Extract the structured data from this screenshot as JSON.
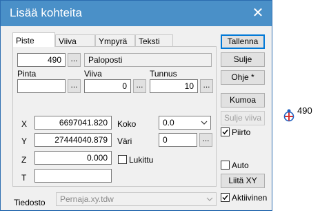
{
  "window": {
    "title": "Lisää kohteita",
    "close_symbol": "✕"
  },
  "tabs": [
    "Piste",
    "Viiva",
    "Ympyrä",
    "Teksti"
  ],
  "code": {
    "value": "490",
    "name": "Paloposti"
  },
  "pinta": {
    "label": "Pinta",
    "value": ""
  },
  "viiva": {
    "label": "Viiva",
    "value": "0"
  },
  "tunnus": {
    "label": "Tunnus",
    "value": "10"
  },
  "dots": "...",
  "coords": {
    "x_label": "X",
    "x_value": "6697041.820",
    "y_label": "Y",
    "y_value": "27444040.879",
    "z_label": "Z",
    "z_value": "0.000",
    "t_label": "T",
    "t_value": ""
  },
  "koko": {
    "label": "Koko",
    "value": "0.0"
  },
  "vari": {
    "label": "Väri",
    "value": "0"
  },
  "lukittu": {
    "label": "Lukittu",
    "checked": false
  },
  "tiedosto": {
    "label": "Tiedosto",
    "value": "Pernaja.xy.tdw"
  },
  "buttons": {
    "tallenna": "Tallenna",
    "sulje": "Sulje",
    "ohje": "Ohje *",
    "kumoa": "Kumoa",
    "sulje_viiva": "Sulje viiva",
    "liita_xy": "Liitä XY"
  },
  "checkboxes": {
    "piirto": {
      "label": "Piirto",
      "checked": true
    },
    "auto": {
      "label": "Auto",
      "checked": false
    },
    "aktiivinen": {
      "label": "Aktiivinen",
      "checked": true
    }
  },
  "marker": {
    "label": "490",
    "icon": "hydrant-marker-icon",
    "color": "#d83030",
    "ring": "#2060c0"
  },
  "colors": {
    "titlebar": "#4a90c8",
    "focus": "#0078d7"
  }
}
